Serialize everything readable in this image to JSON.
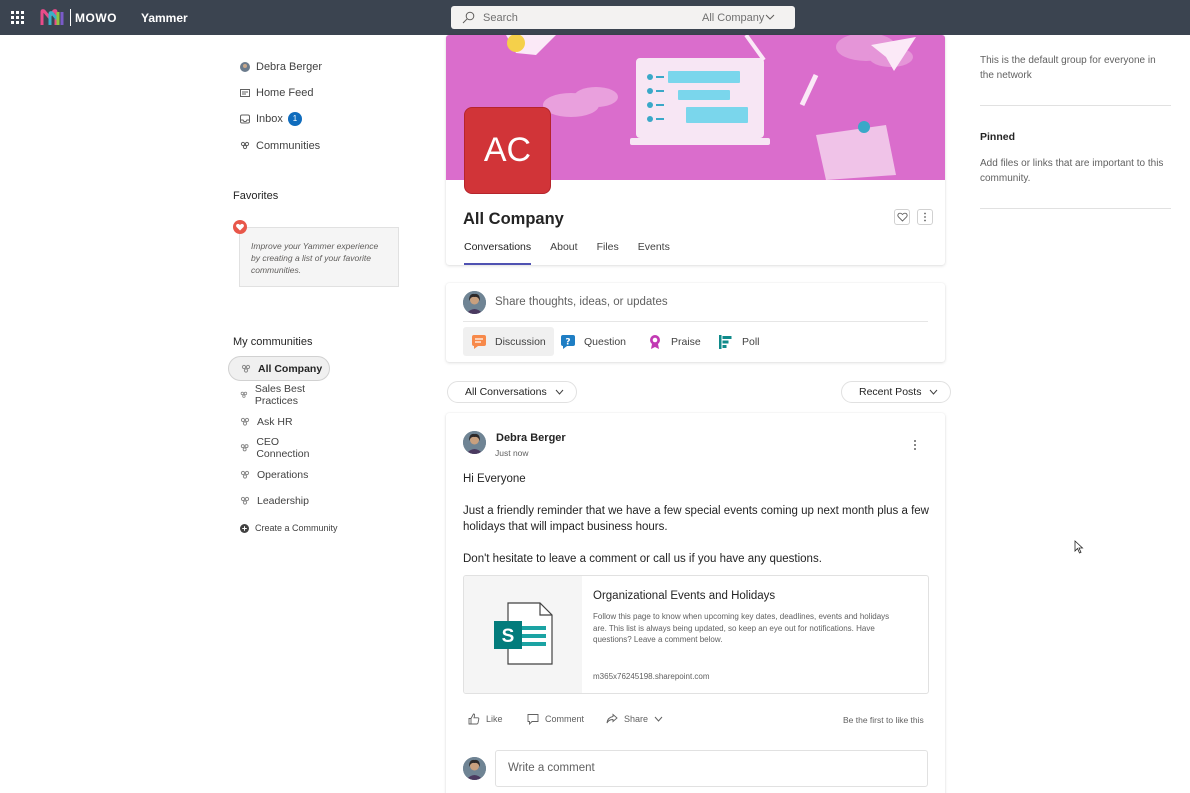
{
  "topbar": {
    "brand": "MOWO",
    "app_name": "Yammer",
    "search_placeholder": "Search",
    "search_scope": "All Company"
  },
  "leftnav": {
    "items": [
      {
        "label": "Debra Berger",
        "icon": "user-avatar-icon"
      },
      {
        "label": "Home Feed",
        "icon": "home-feed-icon"
      },
      {
        "label": "Inbox",
        "icon": "inbox-icon",
        "badge": "1"
      },
      {
        "label": "Communities",
        "icon": "communities-icon"
      }
    ],
    "favorites_title": "Favorites",
    "favorites_hint": "Improve your Yammer experience by creating a list of your favorite communities.",
    "my_communities_title": "My communities",
    "communities": [
      {
        "label": "All Company",
        "active": true
      },
      {
        "label": "Sales Best Practices"
      },
      {
        "label": "Ask HR"
      },
      {
        "label": "CEO Connection"
      },
      {
        "label": "Operations"
      },
      {
        "label": "Leadership"
      }
    ],
    "create_label": "Create a Community"
  },
  "group": {
    "avatar_initials": "AC",
    "avatar_color": "#d13438",
    "banner_color": "#da6dcc",
    "title": "All Company",
    "tabs": [
      {
        "label": "Conversations",
        "active": true
      },
      {
        "label": "About"
      },
      {
        "label": "Files"
      },
      {
        "label": "Events"
      }
    ]
  },
  "composer": {
    "placeholder": "Share thoughts, ideas, or updates",
    "types": [
      {
        "label": "Discussion",
        "icon": "discussion-icon",
        "active": true
      },
      {
        "label": "Question",
        "icon": "question-icon"
      },
      {
        "label": "Praise",
        "icon": "praise-icon"
      },
      {
        "label": "Poll",
        "icon": "poll-icon"
      }
    ]
  },
  "filters": {
    "left": "All Conversations",
    "right": "Recent Posts"
  },
  "post": {
    "author": "Debra Berger",
    "time": "Just now",
    "body": [
      "Hi Everyone",
      "Just a friendly reminder that we have a few special events coming up next month plus a few holidays that will impact business hours.",
      "Don't hesitate to leave a comment or call us if you have any questions."
    ],
    "link": {
      "title": "Organizational Events and Holidays",
      "description": "Follow this page to know when upcoming key dates, deadlines, events and holidays are.  This list is always being updated, so keep an eye out for notifications. Have questions? Leave a comment below.",
      "url": "m365x76245198.sharepoint.com",
      "thumb_letter": "S"
    },
    "actions": {
      "like": "Like",
      "comment": "Comment",
      "share": "Share"
    },
    "first_like": "Be the first to like this",
    "comment_placeholder": "Write a comment"
  },
  "right": {
    "description": "This is the default group for everyone in the network",
    "pinned_title": "Pinned",
    "pinned_hint": "Add files or links that are important to this community."
  }
}
